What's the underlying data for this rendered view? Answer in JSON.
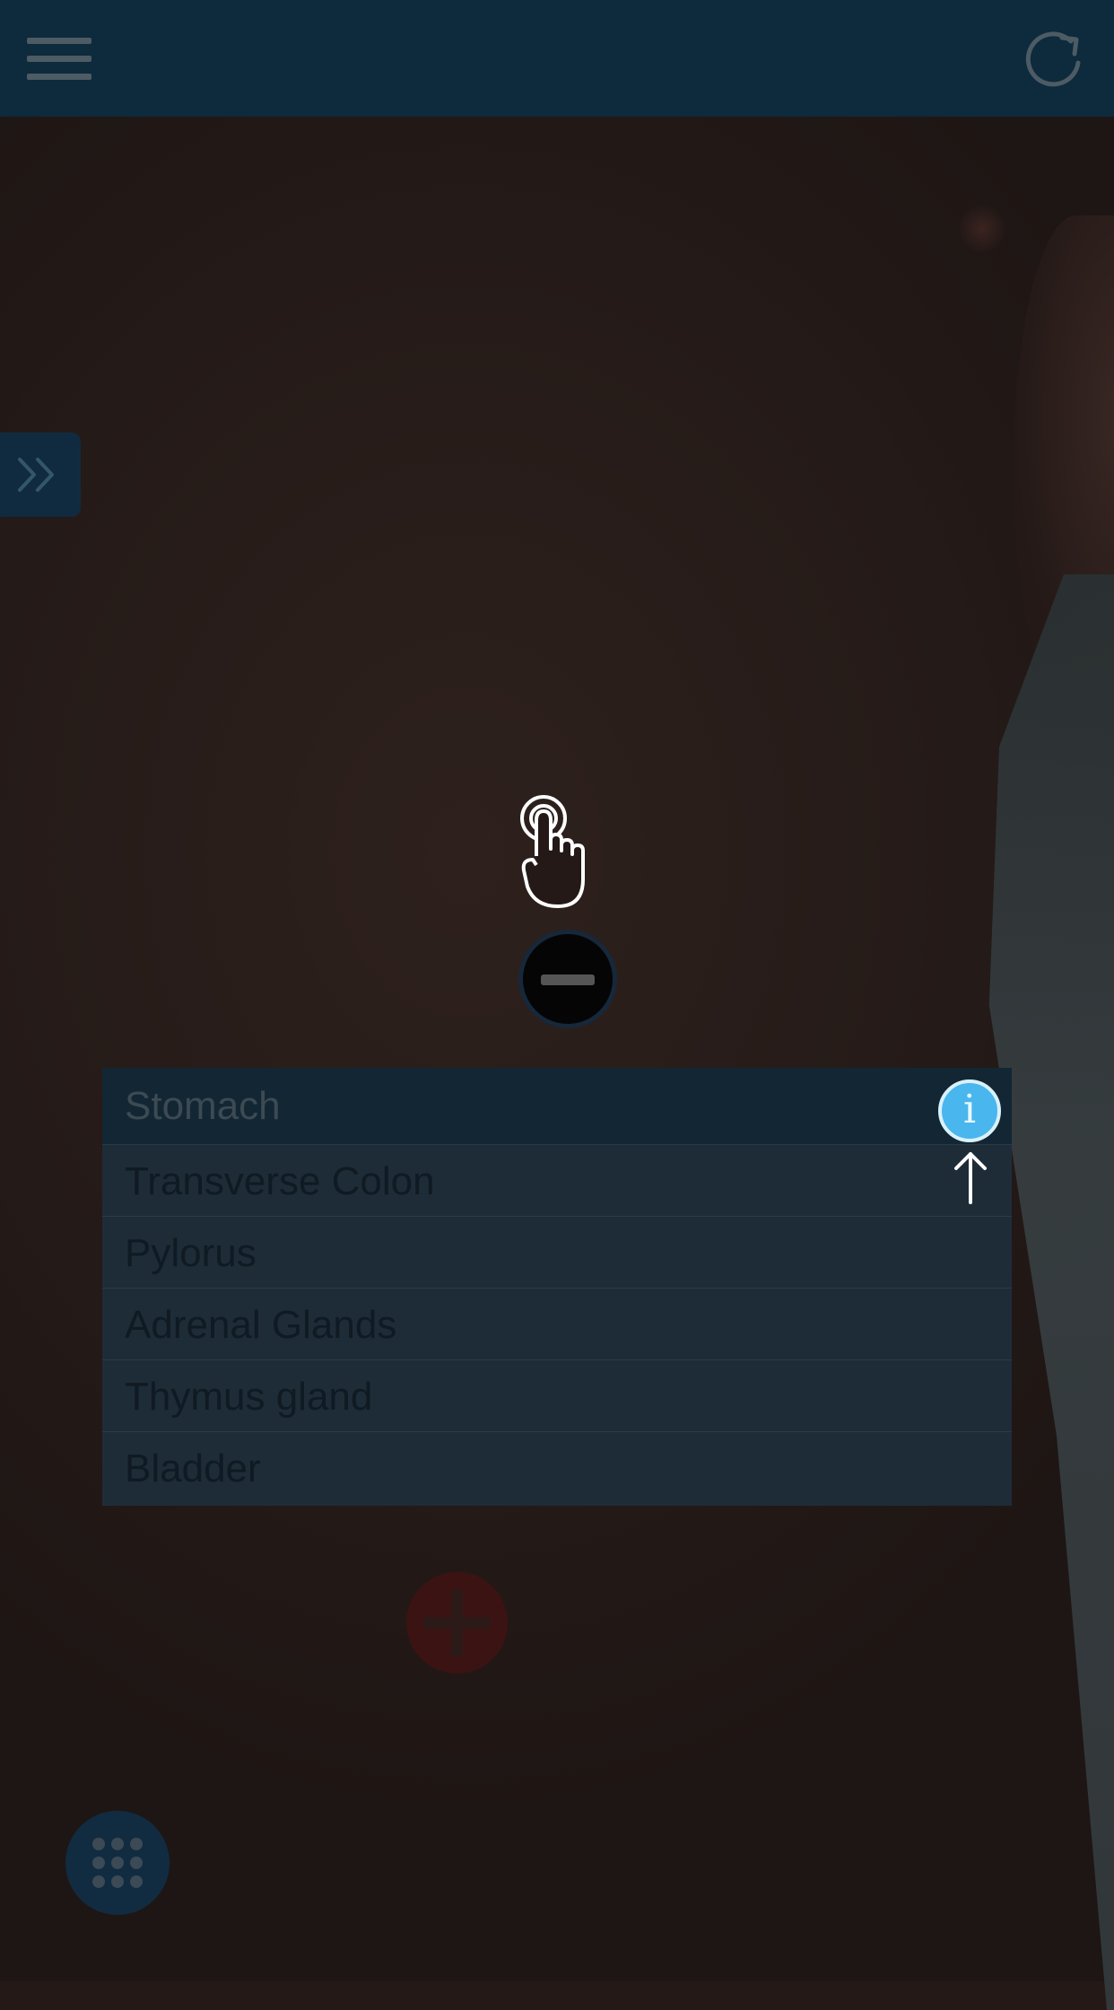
{
  "header": {
    "menu_icon": "hamburger-menu-icon",
    "refresh_icon": "refresh-icon"
  },
  "drawer": {
    "icon": "double-chevron-right-icon"
  },
  "gesture_hint": {
    "icon": "tap-hand-icon"
  },
  "controls": {
    "minus_icon": "minus-circle-icon",
    "plus_icon": "plus-circle-icon",
    "grid_icon": "grid-dots-icon",
    "info_glyph": "i",
    "arrow_icon": "arrow-up-icon"
  },
  "organ_list": {
    "selected_index": 0,
    "items": [
      {
        "label": "Stomach"
      },
      {
        "label": "Transverse Colon"
      },
      {
        "label": "Pylorus"
      },
      {
        "label": "Adrenal Glands"
      },
      {
        "label": "Thymus gland"
      },
      {
        "label": "Bladder"
      }
    ]
  },
  "colors": {
    "topbar": "#0e2a3d",
    "list_background": "#1e2c38",
    "info_accent": "#49b6ee",
    "plus_button": "#3c1313"
  }
}
